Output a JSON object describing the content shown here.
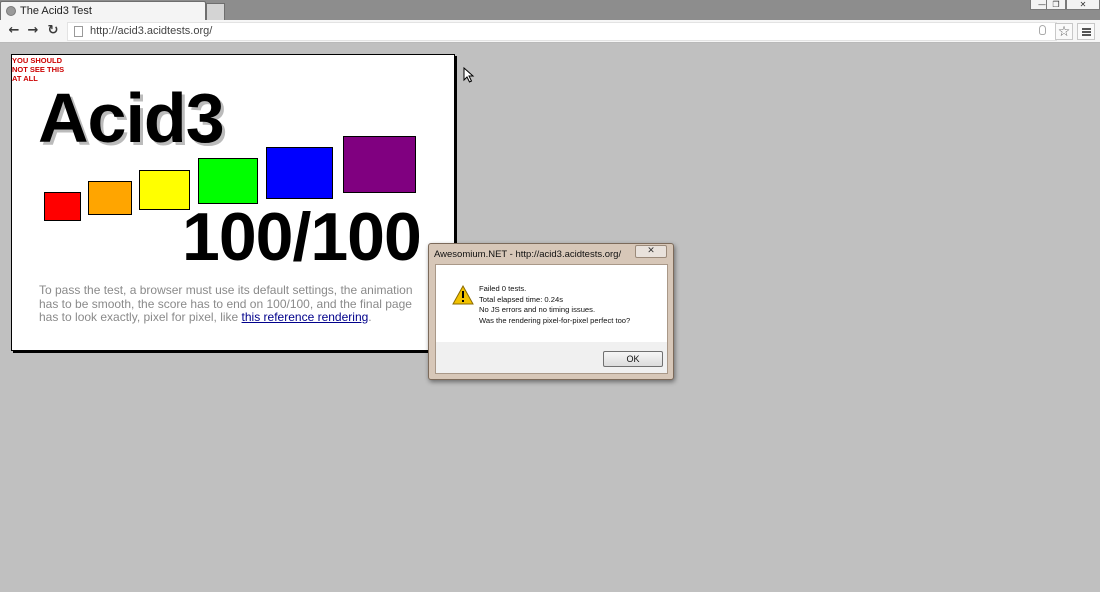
{
  "browser": {
    "tab": {
      "title": "The Acid3 Test"
    },
    "url": "http://acid3.acidtests.org/"
  },
  "page": {
    "warning": "YOU SHOULD NOT SEE THIS AT ALL",
    "title": "Acid3",
    "score": "100/100",
    "instructions_prefix": "To pass the test, a browser must use its default settings, the animation has to be smooth, the score has to end on 100/100, and the final page has to look exactly, pixel for pixel, like ",
    "link_text": "this reference rendering",
    "instructions_suffix": ".",
    "buckets": [
      {
        "name": "bucket-1",
        "color": "#ff0000"
      },
      {
        "name": "bucket-2",
        "color": "#ffa500"
      },
      {
        "name": "bucket-3",
        "color": "#ffff00"
      },
      {
        "name": "bucket-4",
        "color": "#00ff00"
      },
      {
        "name": "bucket-5",
        "color": "#0000ff"
      },
      {
        "name": "bucket-6",
        "color": "#800080"
      }
    ]
  },
  "dialog": {
    "title": "Awesomium.NET - http://acid3.acidtests.org/",
    "icon": "warning-icon",
    "lines": [
      "Failed 0 tests.",
      "Total elapsed time: 0.24s",
      "No JS errors and no timing issues.",
      "Was the rendering pixel-for-pixel perfect too?"
    ],
    "ok_label": "OK"
  }
}
